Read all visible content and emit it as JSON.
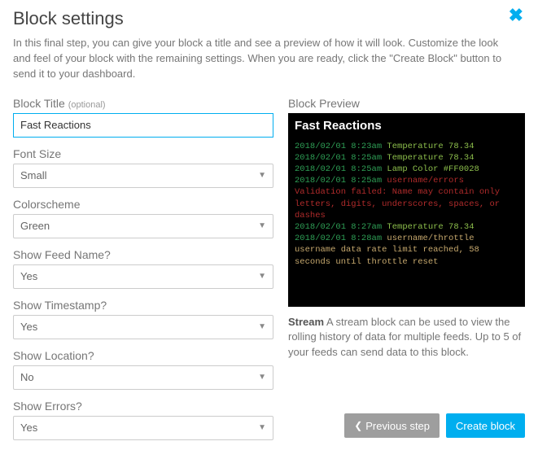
{
  "header": {
    "title": "Block settings",
    "description": "In this final step, you can give your block a title and see a preview of how it will look. Customize the look and feel of your block with the remaining settings. When you are ready, click the \"Create Block\" button to send it to your dashboard."
  },
  "form": {
    "block_title_label": "Block Title",
    "block_title_optional": "(optional)",
    "block_title_value": "Fast Reactions",
    "font_size_label": "Font Size",
    "font_size_value": "Small",
    "colorscheme_label": "Colorscheme",
    "colorscheme_value": "Green",
    "show_feed_name_label": "Show Feed Name?",
    "show_feed_name_value": "Yes",
    "show_timestamp_label": "Show Timestamp?",
    "show_timestamp_value": "Yes",
    "show_location_label": "Show Location?",
    "show_location_value": "No",
    "show_errors_label": "Show Errors?",
    "show_errors_value": "Yes"
  },
  "preview": {
    "label": "Block Preview",
    "title": "Fast Reactions",
    "lines": [
      {
        "ts": "2018/02/01 8:23am",
        "text": "Temperature  78.34",
        "cls": "green"
      },
      {
        "ts": "2018/02/01 8:25am",
        "text": "Temperature  78.34",
        "cls": "green"
      },
      {
        "ts": "2018/02/01 8:25am",
        "text": "Lamp Color  #FF0028",
        "cls": "green"
      },
      {
        "ts": "2018/02/01 8:25am",
        "text": "username/errors",
        "cls": "red"
      },
      {
        "ts": "",
        "text": "Validation failed: Name may contain only letters, digits, underscores, spaces, or dashes",
        "cls": "red"
      },
      {
        "ts": "2018/02/01 8:27am",
        "text": "Temperature  78.34",
        "cls": "green"
      },
      {
        "ts": "2018/02/01 8:28am",
        "text": "username/throttle",
        "cls": "white"
      },
      {
        "ts": "",
        "text": "username data rate limit reached, 58 seconds until throttle reset",
        "cls": "white"
      }
    ],
    "stream_bold": "Stream",
    "stream_desc": " A stream block can be used to view the rolling history of data for multiple feeds. Up to 5 of your feeds can send data to this block."
  },
  "footer": {
    "previous": "Previous step",
    "create": "Create block"
  }
}
